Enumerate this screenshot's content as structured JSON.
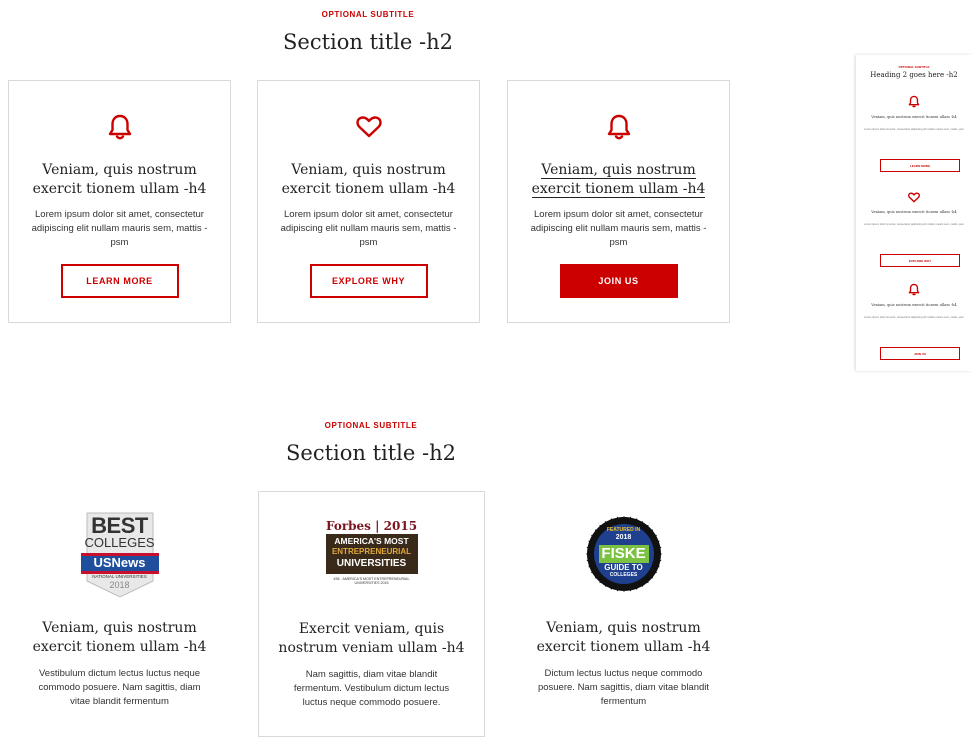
{
  "section1": {
    "subtitle": "OPTIONAL SUBTITLE",
    "title": "Section title -h2",
    "cards": [
      {
        "icon": "bell-icon",
        "heading_line1": "Veniam, quis nostrum",
        "heading_line2": "exercit tionem ullam -h4",
        "body": "Lorem ipsum dolor sit amet, consectetur adipiscing elit nullam mauris sem, mattis -psm",
        "button": "LEARN MORE"
      },
      {
        "icon": "heart-icon",
        "heading_line1": "Veniam, quis nostrum",
        "heading_line2": "exercit tionem ullam -h4",
        "body": "Lorem ipsum dolor sit amet, consectetur adipiscing elit nullam mauris sem, mattis -psm",
        "button": "EXPLORE WHY"
      },
      {
        "icon": "bell-icon",
        "heading_line1": "Veniam, quis nostrum",
        "heading_line2": "exercit tionem ullam -h4",
        "body": "Lorem ipsum dolor sit amet, consectetur adipiscing elit nullam mauris sem, mattis -psm",
        "button": "JOIN US"
      }
    ]
  },
  "mobile": {
    "subtitle": "OPTIONAL SUBTITLE",
    "title": "Heading 2 goes here -h2",
    "items": [
      {
        "heading": "Veniam, quis nostrum exercit tionem ullam -h4",
        "body": "Lorem ipsum dolor sit amet, consectetur adipiscing elit nullam mauris sem, mattis -psm",
        "button": "LEARN MORE"
      },
      {
        "heading": "Veniam, quis nostrum exercit tionem ullam -h4",
        "body": "Lorem ipsum dolor sit amet, consectetur adipiscing elit nullam mauris sem, mattis -psm",
        "button": "EXPLORE WHY"
      },
      {
        "heading": "Veniam, quis nostrum exercit tionem ullam -h4",
        "body": "Lorem ipsum dolor sit amet, consectetur adipiscing elit nullam mauris sem, mattis -psm",
        "button": "JOIN US"
      }
    ]
  },
  "section2": {
    "subtitle": "OPTIONAL SUBTITLE",
    "title": "Section title -h2",
    "cards": [
      {
        "logo": {
          "line1": "BEST",
          "line2": "COLLEGES",
          "line3": "USNews",
          "line4": "NATIONAL UNIVERSITIES",
          "line5": "2018"
        },
        "heading_line1": "Veniam, quis nostrum",
        "heading_line2": "exercit tionem ullam -h4",
        "body": "Vestibulum dictum lectus luctus neque commodo posuere. Nam sagittis, diam vitae blandit fermentum"
      },
      {
        "logo": {
          "line1": "Forbes | 2015",
          "line2": "AMERICA'S MOST",
          "line3": "ENTREPRENEURIAL",
          "line4": "UNIVERSITIES",
          "line5": "#36 · AMERICA'S MOST ENTREPRENEURIAL UNIVERSITIES 2015"
        },
        "heading_line1": "Exercit veniam, quis",
        "heading_line2": "nostrum veniam ullam -h4",
        "body": "Nam sagittis, diam vitae blandit fermentum. Vestibulum dictum lectus luctus neque commodo posuere."
      },
      {
        "logo": {
          "line1": "FEATURED IN",
          "line2": "2018",
          "line3": "FISKE",
          "line4": "GUIDE TO",
          "line5": "COLLEGES"
        },
        "heading_line1": "Veniam, quis nostrum",
        "heading_line2": "exercit tionem ullam -h4",
        "body": "Dictum lectus luctus neque commodo posuere. Nam sagittis, diam vitae blandit fermentum"
      }
    ]
  },
  "colors": {
    "accent": "#cc0000",
    "border": "#d9d9d9",
    "text": "#222222"
  }
}
